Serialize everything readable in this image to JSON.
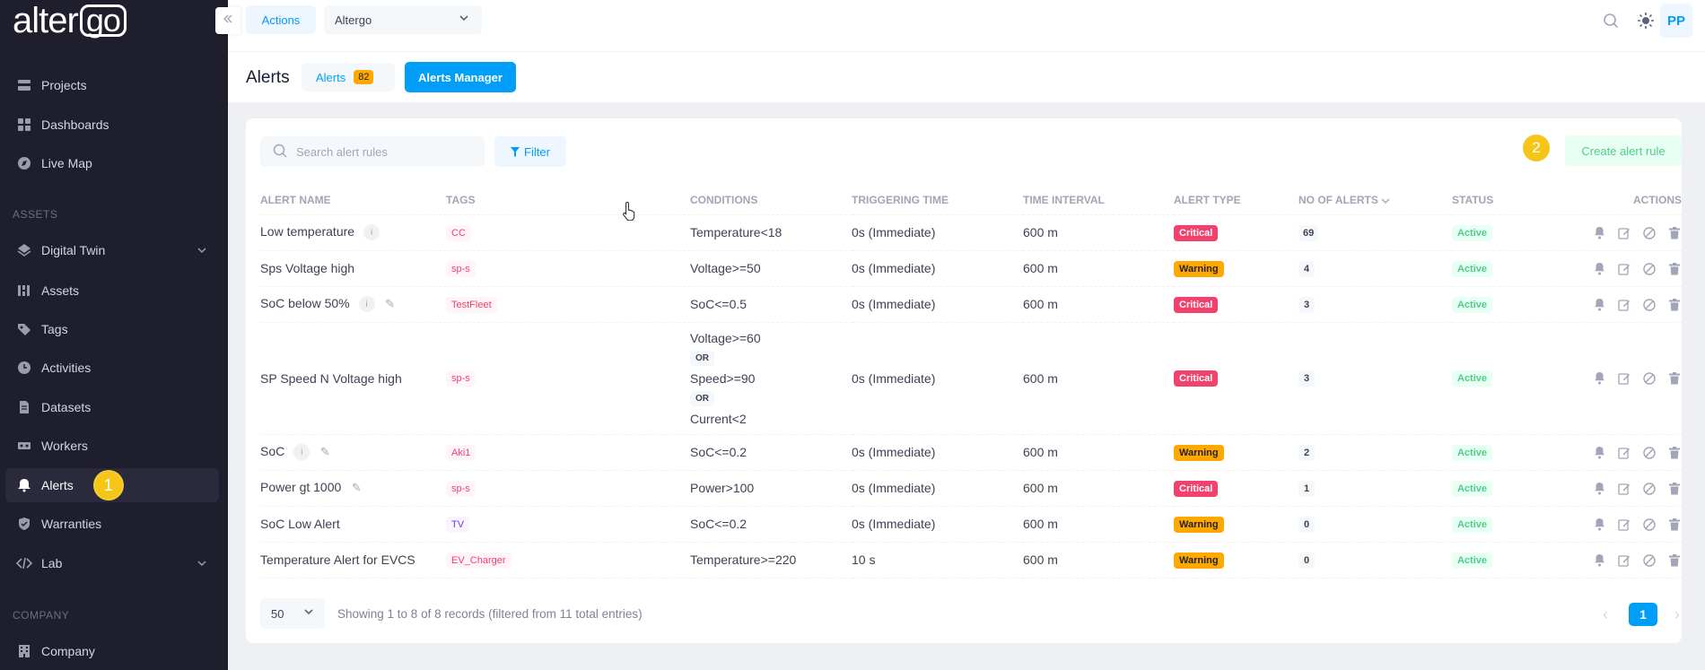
{
  "brand": {
    "logo_left": "alter",
    "logo_right": "go"
  },
  "sidebar": {
    "collapse_icon": "double-chevron-left",
    "items": [
      {
        "label": "Projects",
        "icon": "projects-icon"
      },
      {
        "label": "Dashboards",
        "icon": "dashboards-icon"
      },
      {
        "label": "Live Map",
        "icon": "compass-icon"
      },
      {
        "label": "Digital Twin",
        "icon": "layers-icon"
      },
      {
        "label": "Assets",
        "icon": "assets-icon"
      },
      {
        "label": "Tags",
        "icon": "tag-icon"
      },
      {
        "label": "Activities",
        "icon": "clock-icon"
      },
      {
        "label": "Datasets",
        "icon": "document-icon"
      },
      {
        "label": "Workers",
        "icon": "worker-icon"
      },
      {
        "label": "Alerts",
        "icon": "bell-icon"
      },
      {
        "label": "Warranties",
        "icon": "shield-icon"
      },
      {
        "label": "Lab",
        "icon": "code-icon"
      },
      {
        "label": "Company",
        "icon": "building-icon"
      }
    ],
    "section_assets": "ASSETS",
    "section_company": "COMPANY",
    "step_badge": "1"
  },
  "topbar": {
    "actions_label": "Actions",
    "org_value": "Altergo",
    "avatar_initials": "PP"
  },
  "header": {
    "title": "Alerts",
    "tab_alerts": "Alerts",
    "tab_alerts_count": "82",
    "tab_manager": "Alerts Manager"
  },
  "toolbar": {
    "search_placeholder": "Search alert rules",
    "filter_label": "Filter",
    "step_badge": "2",
    "create_label": "Create alert rule"
  },
  "table": {
    "columns": [
      "ALERT NAME",
      "TAGS",
      "CONDITIONS",
      "TRIGGERING TIME",
      "TIME INTERVAL",
      "ALERT TYPE",
      "NO OF ALERTS",
      "STATUS",
      "ACTIONS"
    ],
    "rows": [
      {
        "name": "Low temperature",
        "tag": "CC",
        "conditions": [
          "Temperature<18"
        ],
        "triggering": "0s (Immediate)",
        "interval": "600 m",
        "type": "Critical",
        "count": "69",
        "status": "Active"
      },
      {
        "name": "Sps Voltage high",
        "tag": "sp-s",
        "conditions": [
          "Voltage>=50"
        ],
        "triggering": "0s (Immediate)",
        "interval": "600 m",
        "type": "Warning",
        "count": "4",
        "status": "Active"
      },
      {
        "name": "SoC below 50%",
        "tag": "TestFleet",
        "conditions": [
          "SoC<=0.5"
        ],
        "triggering": "0s (Immediate)",
        "interval": "600 m",
        "type": "Critical",
        "count": "3",
        "status": "Active"
      },
      {
        "name": "SP Speed N Voltage high",
        "tag": "sp-s",
        "conditions": [
          "Voltage>=60",
          "OR",
          "Speed>=90",
          "OR",
          "Current<2"
        ],
        "triggering": "0s (Immediate)",
        "interval": "600 m",
        "type": "Critical",
        "count": "3",
        "status": "Active"
      },
      {
        "name": "SoC",
        "tag": "Aki1",
        "conditions": [
          "SoC<=0.2"
        ],
        "triggering": "0s (Immediate)",
        "interval": "600 m",
        "type": "Warning",
        "count": "2",
        "status": "Active"
      },
      {
        "name": "Power gt 1000",
        "tag": "sp-s",
        "conditions": [
          "Power>100"
        ],
        "triggering": "0s (Immediate)",
        "interval": "600 m",
        "type": "Critical",
        "count": "1",
        "status": "Active"
      },
      {
        "name": "SoC Low Alert",
        "tag": "TV",
        "conditions": [
          "SoC<=0.2"
        ],
        "triggering": "0s (Immediate)",
        "interval": "600 m",
        "type": "Warning",
        "count": "0",
        "status": "Active"
      },
      {
        "name": "Temperature Alert for EVCS",
        "tag": "EV_Charger",
        "conditions": [
          "Temperature>=220"
        ],
        "triggering": "10 s",
        "interval": "600 m",
        "type": "Warning",
        "count": "0",
        "status": "Active"
      }
    ]
  },
  "footer": {
    "per_page": "50",
    "showing_text": "Showing 1 to 8 of 8 records (filtered from 11 total entries)",
    "current_page": "1"
  },
  "colors": {
    "accent": "#009ef7",
    "critical": "#f1416c",
    "warning": "#ffa800",
    "active": "#50cd89",
    "sidebar_bg": "#1e1e2d"
  }
}
